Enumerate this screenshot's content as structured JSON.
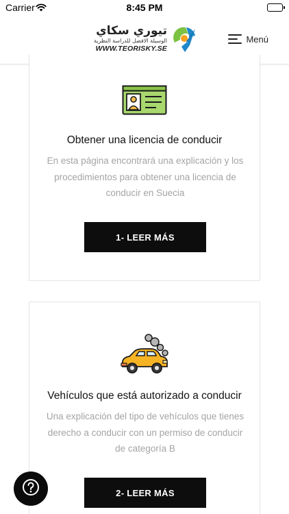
{
  "status_bar": {
    "carrier": "Carrier",
    "time": "8:45 PM",
    "wifi_icon": "wifi-icon",
    "battery_icon": "battery-icon"
  },
  "header": {
    "logo": {
      "arabic_title": "تيوري سكاي",
      "arabic_subtitle": "الوسيلة الافضل للدراسة النظرية",
      "url": "WWW.TEORISKY.SE",
      "mark_icon": "teorisky-logo-icon",
      "colors": {
        "green": "#7cc242",
        "blue": "#1e88c8",
        "orange": "#f6a21d"
      }
    },
    "menu_label": "Menú",
    "menu_icon": "hamburger-icon"
  },
  "cards": [
    {
      "icon": "license-card-icon",
      "title": "Obtener una licencia de conducir",
      "description": "En esta página encontrará una explicación y los procedimientos para obtener una licencia de conducir en Suecia",
      "button_label": "1- LEER MÁS"
    },
    {
      "icon": "car-icon",
      "title": "Vehículos que está autorizado a conducir",
      "description": "Una explicación del tipo de vehículos que tienes derecho a conducir con un permiso de conducir de categoría B",
      "button_label": "2- LEER MÁS"
    }
  ],
  "help_button": {
    "icon": "question-mark-icon"
  },
  "colors": {
    "button_bg": "#0d0d0d",
    "description_text": "#a4a4a4",
    "card_border": "#e4e4e4"
  }
}
